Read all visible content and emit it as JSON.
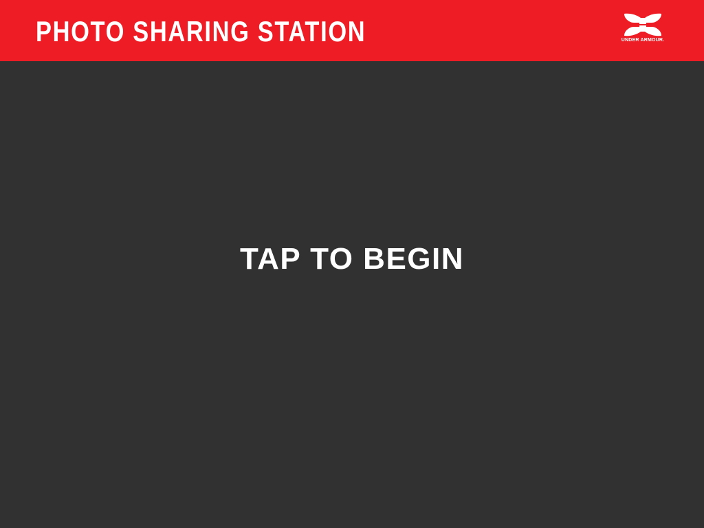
{
  "header": {
    "title": "PHOTO SHARING STATION",
    "background_color": "#ee1c25"
  },
  "brand": {
    "icon": "under-armour-logo-icon",
    "text": "UNDER ARMOUR."
  },
  "main": {
    "prompt": "TAP TO BEGIN",
    "background_color": "#313131"
  }
}
